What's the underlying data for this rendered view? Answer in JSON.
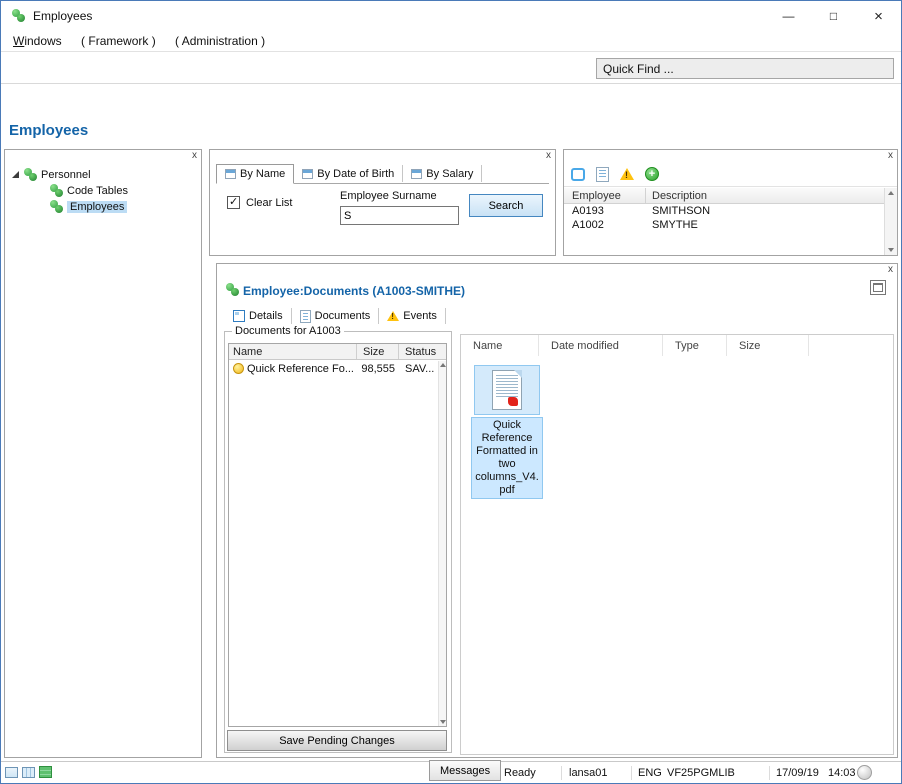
{
  "colors": {
    "accent": "#1464a8",
    "selection": "#cce8ff",
    "window_border": "#4a7ab8"
  },
  "window": {
    "title": "Employees",
    "minimize_glyph": "—",
    "maximize_glyph": "□",
    "close_glyph": "×"
  },
  "menu_bar": {
    "items": [
      {
        "label": "Windows"
      },
      {
        "label": "( Framework )"
      },
      {
        "label": "( Administration )"
      }
    ]
  },
  "quick_find": {
    "value": "Quick Find ..."
  },
  "page": {
    "heading": "Employees"
  },
  "tree_panel": {
    "close_label": "x",
    "root": {
      "label": "Personnel"
    },
    "items": [
      {
        "label": "Code Tables",
        "selected": false
      },
      {
        "label": "Employees",
        "selected": true
      }
    ]
  },
  "search_panel": {
    "close_label": "x",
    "tabs": [
      {
        "label": "By Name",
        "active": true
      },
      {
        "label": "By Date of Birth",
        "active": false
      },
      {
        "label": "By Salary",
        "active": false
      }
    ],
    "clear_list_label": "Clear List",
    "clear_list_checked": true,
    "surname_label": "Employee Surname",
    "surname_value": "S",
    "search_button_label": "Search"
  },
  "employees_panel": {
    "close_label": "x",
    "toolbar_icons": [
      "select-icon",
      "document-icon",
      "warning-icon",
      "add-icon"
    ],
    "columns": [
      {
        "label": "Employee"
      },
      {
        "label": "Description"
      }
    ],
    "rows": [
      {
        "employee": "A0193",
        "description": "SMITHSON"
      },
      {
        "employee": "A1002",
        "description": "SMYTHE"
      }
    ]
  },
  "documents_panel": {
    "close_label": "x",
    "title": "Employee:Documents (A1003-SMITHE)",
    "tabs": [
      {
        "label": "Details",
        "active": false
      },
      {
        "label": "Documents",
        "active": true
      },
      {
        "label": "Events",
        "active": false
      }
    ],
    "group_title": "Documents for A1003",
    "list": {
      "columns": [
        {
          "label": "Name"
        },
        {
          "label": "Size"
        },
        {
          "label": "Status"
        }
      ],
      "rows": [
        {
          "name": "Quick Reference Fo...",
          "size": "98,555",
          "status": "SAV..."
        }
      ]
    },
    "save_button_label": "Save Pending Changes",
    "files": {
      "columns": [
        {
          "label": "Name"
        },
        {
          "label": "Date modified"
        },
        {
          "label": "Type"
        },
        {
          "label": "Size"
        }
      ],
      "items": [
        {
          "label": "Quick Reference Formatted in two columns_V4.pdf",
          "selected": true
        }
      ]
    }
  },
  "status_bar": {
    "messages_label": "Messages",
    "ready_label": "Ready",
    "user": "lansa01",
    "language": "ENG",
    "library": "VF25PGMLIB",
    "date": "17/09/19",
    "time": "14:03"
  }
}
